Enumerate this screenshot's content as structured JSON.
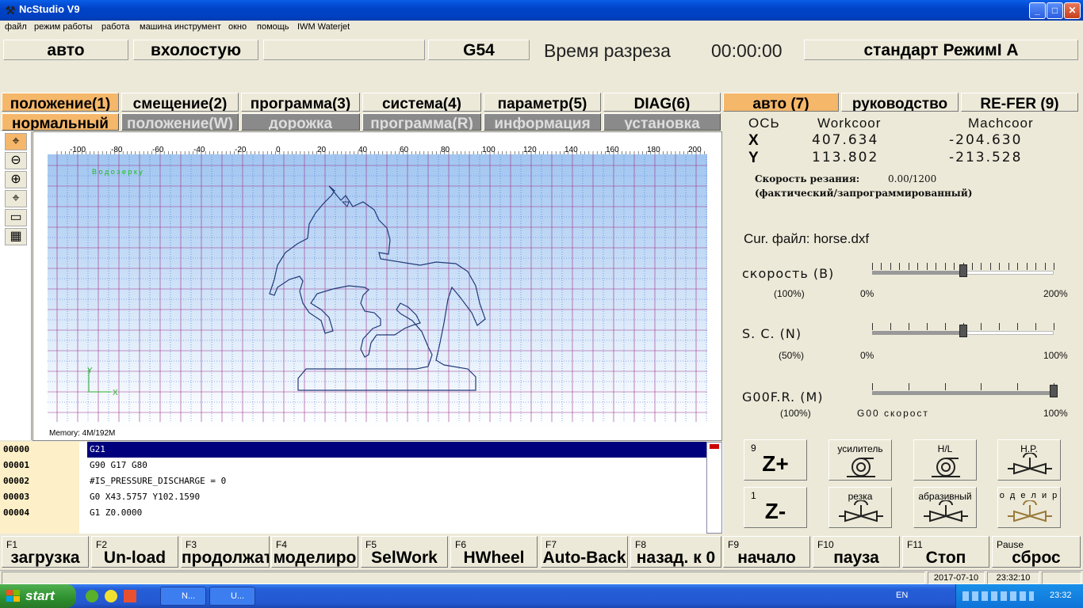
{
  "window": {
    "title": "NcStudio V9"
  },
  "menu": [
    "файл",
    "режим работы",
    "работа",
    "машина инструмент",
    "окно",
    "помощь",
    "IWM Waterjet"
  ],
  "status": {
    "mode": "авто",
    "state": "вхолостую",
    "wcs": "G54",
    "cut_time_label": "Время разреза",
    "cut_time": "00:00:00",
    "std_mode": "стандарт РежимI А"
  },
  "tabs_left": [
    "положение(1)",
    "смещение(2)",
    "программа(3)",
    "система(4)",
    "параметр(5)",
    "DIAG(6)"
  ],
  "subtabs_left": [
    "нормальный",
    "положение(W)",
    "дорожка",
    "программа(R)",
    "информация",
    "установка"
  ],
  "tabs_right": [
    "авто (7)",
    "руководство",
    "RE-FER (9)"
  ],
  "coords": {
    "header_axis": "ОСЬ",
    "header_work": "Workcoor",
    "header_mach": "Machcoor",
    "x_label": "X",
    "x_work": "407.634",
    "x_mach": "-204.630",
    "y_label": "Y",
    "y_work": "113.802",
    "y_mach": "-213.528"
  },
  "cut_speed": {
    "label": "Скорость резания:",
    "value": "0.00/1200",
    "note": "(фактический/запрограммированный)"
  },
  "current_file": "Cur. файл: horse.dxf",
  "sliders": [
    {
      "label": "скорость (B)",
      "value_text": "(100%)",
      "min_text": "0%",
      "max_text": "200%",
      "level": 0.5
    },
    {
      "label": "S. C. (N)",
      "value_text": "(50%)",
      "min_text": "0%",
      "max_text": "100%",
      "level": 0.5
    },
    {
      "label": "G00F.R. (M)",
      "value_text": "(100%)",
      "min_text": "G00 скорост",
      "max_text": "100%",
      "level": 1.0
    }
  ],
  "buttons": {
    "zplus": "Z+",
    "zplus_sup": "9",
    "zminus": "Z-",
    "zminus_sup": "1",
    "amp": "усилитель",
    "hl": "H/L",
    "hp": "H.P.",
    "cut": "резка",
    "abrasive": "абразивный",
    "model": "о д е л и р"
  },
  "canvas": {
    "memory": "Memory: 4M/192M",
    "green_label": "В о д о з е р к у",
    "x_ticks": [
      "-100",
      "-80",
      "-60",
      "-40",
      "-20",
      "0",
      "20",
      "40",
      "60",
      "80",
      "100",
      "120",
      "140",
      "160",
      "180",
      "200"
    ]
  },
  "gcode": [
    {
      "no": "00000",
      "text": "G21"
    },
    {
      "no": "00001",
      "text": "G90 G17 G80"
    },
    {
      "no": "00002",
      "text": "#IS_PRESSURE_DISCHARGE = 0"
    },
    {
      "no": "00003",
      "text": "G0 X43.5757 Y102.1590"
    },
    {
      "no": "00004",
      "text": "G1 Z0.0000"
    }
  ],
  "fkeys": [
    {
      "key": "F1",
      "label": "загрузка"
    },
    {
      "key": "F2",
      "label": "Un-load"
    },
    {
      "key": "F3",
      "label": "продолжать"
    },
    {
      "key": "F4",
      "label": "моделиро"
    },
    {
      "key": "F5",
      "label": "SelWork"
    },
    {
      "key": "F6",
      "label": "HWheel"
    },
    {
      "key": "F7",
      "label": "Auto-Back"
    },
    {
      "key": "F8",
      "label": "назад. к 0"
    },
    {
      "key": "F9",
      "label": "начало"
    },
    {
      "key": "F10",
      "label": "пауза"
    },
    {
      "key": "F11",
      "label": "Стоп"
    },
    {
      "key": "Pause",
      "label": "сброс"
    }
  ],
  "statusbar": {
    "date": "2017-07-10",
    "time": "23:32:10"
  },
  "taskbar": {
    "start": "start",
    "task1": "N...",
    "task2": "U...",
    "lang": "EN",
    "clock": "23:32"
  },
  "colors": {
    "active_tab": "#f5b76a",
    "gcode_select": "#00007c",
    "titlebar": "#0043c8"
  }
}
